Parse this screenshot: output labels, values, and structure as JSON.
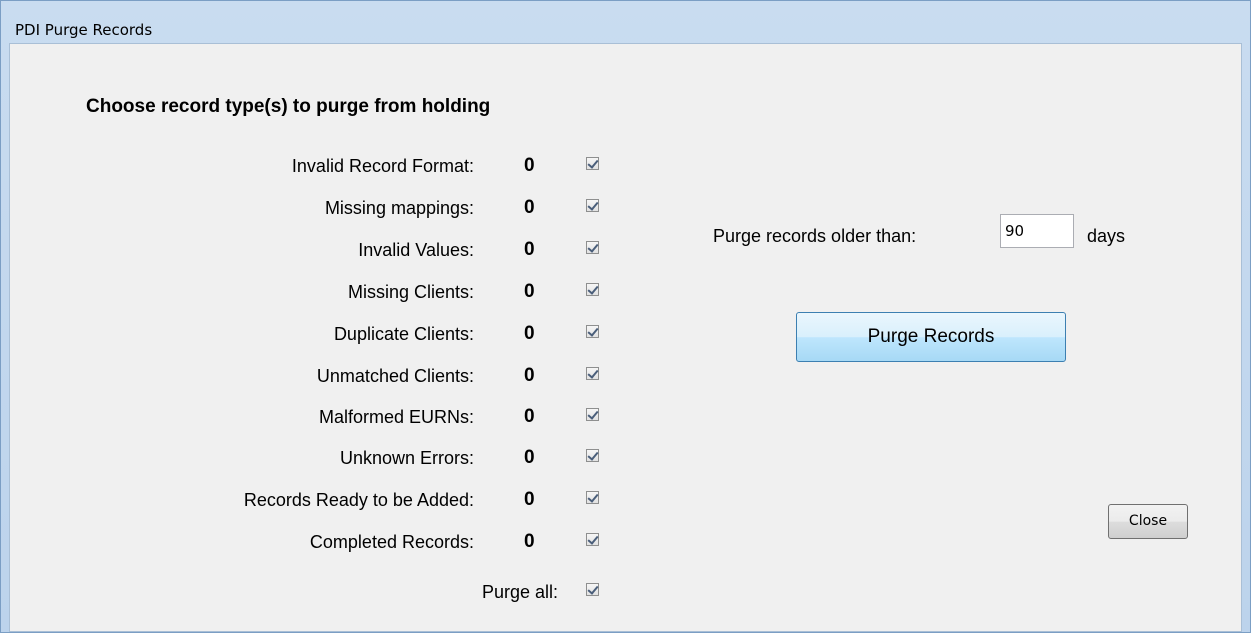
{
  "window": {
    "title": "PDI Purge Records"
  },
  "main": {
    "heading": "Choose record type(s) to purge from holding",
    "record_types": [
      {
        "label": "Invalid Record Format:",
        "count": "0",
        "checked": true
      },
      {
        "label": "Missing mappings:",
        "count": "0",
        "checked": true
      },
      {
        "label": "Invalid Values:",
        "count": "0",
        "checked": true
      },
      {
        "label": "Missing Clients:",
        "count": "0",
        "checked": true
      },
      {
        "label": "Duplicate Clients:",
        "count": "0",
        "checked": true
      },
      {
        "label": "Unmatched Clients:",
        "count": "0",
        "checked": true
      },
      {
        "label": "Malformed EURNs:",
        "count": "0",
        "checked": true
      },
      {
        "label": "Unknown Errors:",
        "count": "0",
        "checked": true
      },
      {
        "label": "Records Ready to be Added:",
        "count": "0",
        "checked": true
      },
      {
        "label": "Completed Records:",
        "count": "0",
        "checked": true
      }
    ],
    "purge_all": {
      "label": "Purge all:",
      "checked": true
    },
    "age_filter": {
      "label": "Purge records older than:",
      "value": "90",
      "unit": "days"
    },
    "purge_button": "Purge Records",
    "close_button": "Close"
  }
}
